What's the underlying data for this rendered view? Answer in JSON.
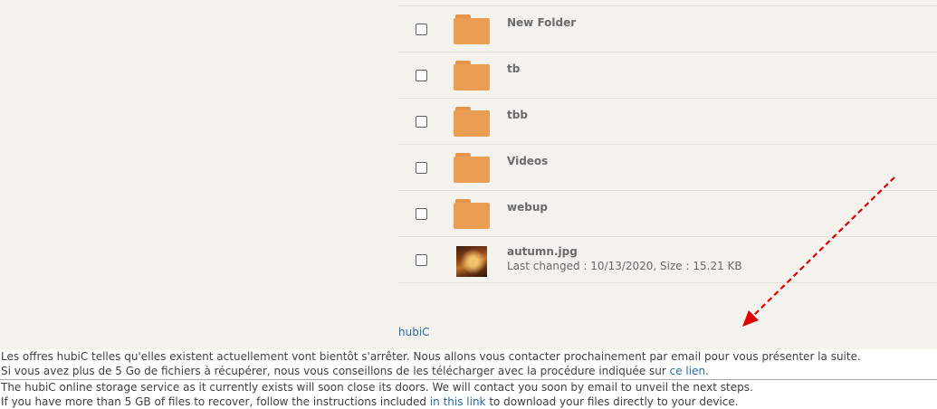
{
  "file_list": {
    "folders": [
      {
        "name": "New Folder"
      },
      {
        "name": "tb"
      },
      {
        "name": "tbb"
      },
      {
        "name": "Videos"
      },
      {
        "name": "webup"
      }
    ],
    "files": [
      {
        "name": "autumn.jpg",
        "meta": "Last changed : 10/13/2020, Size : 15.21 KB"
      }
    ]
  },
  "footer": {
    "brand_link": "hubiC"
  },
  "annotation": {
    "arrow_color": "#e00000"
  },
  "notice": {
    "fr": {
      "line1": "Les offres hubiC telles qu'elles existent actuellement vont bientôt s'arrêter. Nous allons vous contacter prochainement par email pour vous présenter la suite.",
      "line2_prefix": "Si vous avez plus de 5 Go de fichiers à récupérer, nous vous conseillons de les télécharger avec la procédure indiquée sur ",
      "line2_link": "ce lien",
      "line2_suffix": "."
    },
    "en": {
      "line1": "The hubiC online storage service as it currently exists will soon close its doors. We will contact you soon by email to unveil the next steps.",
      "line2_prefix": "If you have more than 5 GB of files to recover, follow the instructions included ",
      "line2_link": "in this link",
      "line2_suffix": " to download your files directly to your device."
    }
  }
}
